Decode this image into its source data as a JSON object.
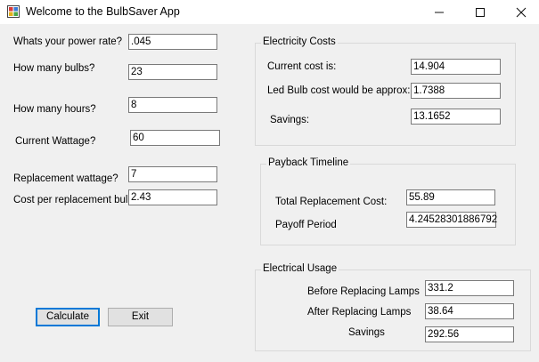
{
  "window": {
    "title": "Welcome to the BulbSaver App",
    "minimize_icon": "minimize-icon",
    "maximize_icon": "maximize-icon",
    "close_icon": "close-icon"
  },
  "inputs": {
    "power_rate": {
      "label": "Whats your power rate?",
      "value": ".045"
    },
    "bulbs": {
      "label": "How many bulbs?",
      "value": "23"
    },
    "hours": {
      "label": "How many hours?",
      "value": "8"
    },
    "current_wattage": {
      "label": "Current Wattage?",
      "value": "60"
    },
    "replacement_wattage": {
      "label": "Replacement wattage?",
      "value": "7"
    },
    "cost_per_bulb": {
      "label": "Cost per replacement bulb:",
      "value": "2.43"
    }
  },
  "electricity_costs": {
    "title": "Electricity Costs",
    "current_cost": {
      "label": "Current cost is:",
      "value": "14.904"
    },
    "led_cost": {
      "label": "Led Bulb cost would be approx:",
      "value": "1.7388"
    },
    "savings": {
      "label": "Savings:",
      "value": "13.1652"
    }
  },
  "payback": {
    "title": "Payback Timeline",
    "total_cost": {
      "label": "Total Replacement Cost:",
      "value": "55.89"
    },
    "payoff_period": {
      "label": "Payoff Period",
      "value": "4.24528301886792"
    }
  },
  "usage": {
    "title": "Electrical Usage",
    "before": {
      "label": "Before Replacing Lamps",
      "value": "331.2"
    },
    "after": {
      "label": "After Replacing Lamps",
      "value": "38.64"
    },
    "savings": {
      "label": "Savings",
      "value": "292.56"
    }
  },
  "buttons": {
    "calculate": "Calculate",
    "exit": "Exit"
  },
  "colors": {
    "accent": "#0078d7",
    "window_bg": "#f0f0f0"
  }
}
